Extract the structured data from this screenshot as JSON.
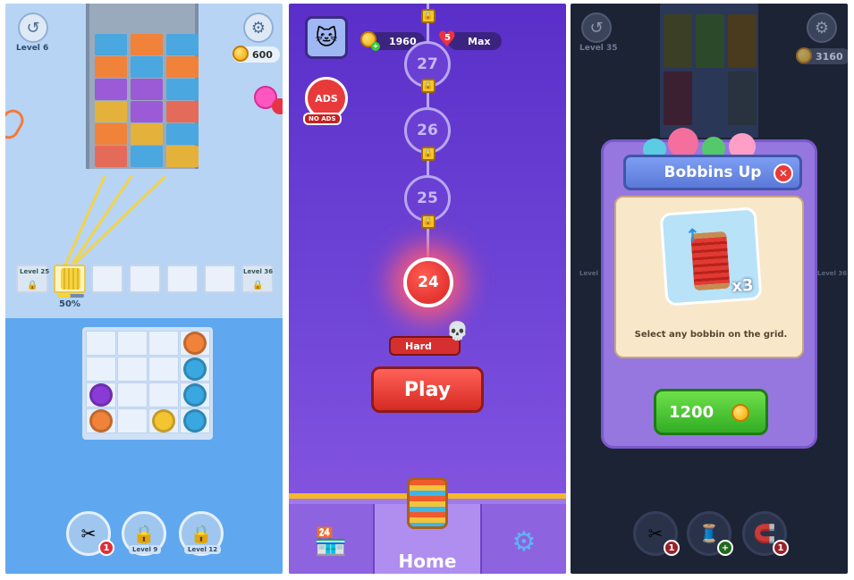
{
  "panel1": {
    "level_label": "Level 6",
    "coins": "600",
    "slot_left_label": "Level 25",
    "slot_right_label": "Level 36",
    "progress": "50%",
    "booster_badge": "1",
    "booster2_label": "Level 9",
    "booster3_label": "Level 12",
    "accent": "#5fa8f0"
  },
  "panel2": {
    "coins": "1960",
    "lives_count": "5",
    "lives_label": "Max",
    "ads_label": "ADS",
    "no_ads_label": "NO ADS",
    "levels": [
      "27",
      "26",
      "25"
    ],
    "current_level": "24",
    "difficulty": "Hard",
    "play_label": "Play",
    "home_label": "Home",
    "accent": "#e8403c"
  },
  "panel3": {
    "level_label": "Level 35",
    "coins": "3160",
    "slot_left_label": "Level 12",
    "slot_right_label": "Level 36",
    "dialog_title": "Bobbins Up",
    "multiplier": "x3",
    "description": "Select any bobbin on the grid.",
    "price": "1200",
    "booster1_badge": "1",
    "booster3_badge": "1",
    "accent": "#32ad24"
  }
}
